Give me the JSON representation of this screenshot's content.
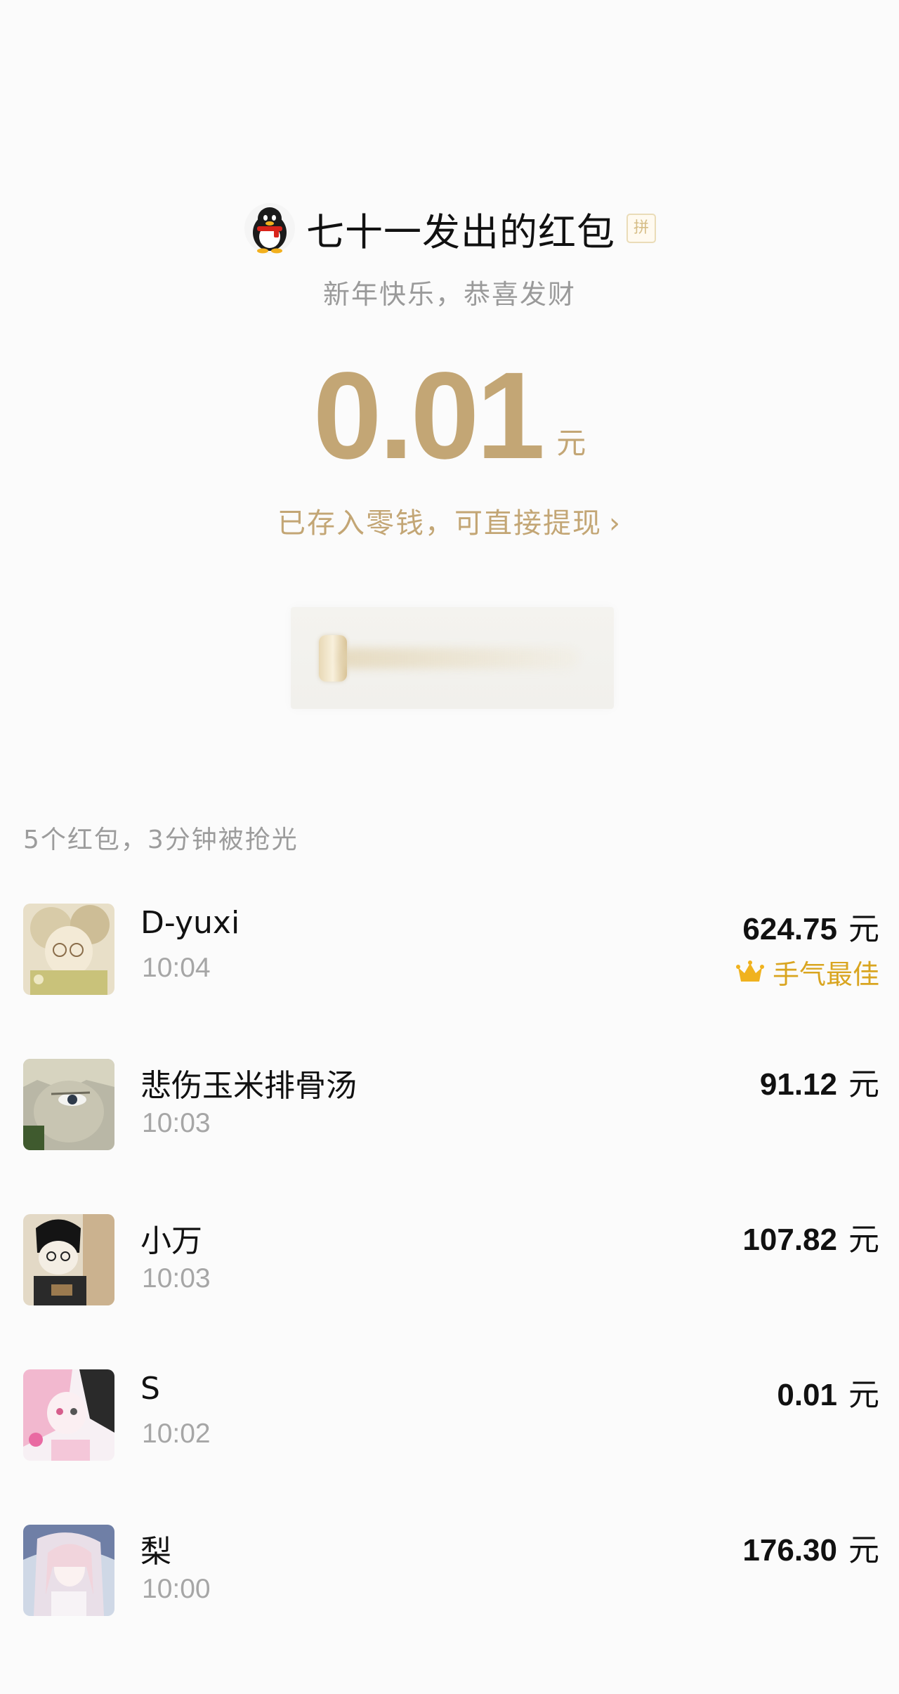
{
  "packet": {
    "title": "七十一发出的红包",
    "badge": "拼",
    "greeting": "新年快乐，恭喜发财",
    "amount": "0.01",
    "unit": "元",
    "saved_text": "已存入零钱，可直接提现",
    "chevron": "›"
  },
  "summary": "5个红包，3分钟被抢光",
  "records": [
    {
      "name": "D-yuxi",
      "time": "10:04",
      "amount": "624.75",
      "unit": "元",
      "best_label": "手气最佳"
    },
    {
      "name": "悲伤玉米排骨汤",
      "time": "10:03",
      "amount": "91.12",
      "unit": "元"
    },
    {
      "name": "小万",
      "time": "10:03",
      "amount": "107.82",
      "unit": "元"
    },
    {
      "name": "S",
      "time": "10:02",
      "amount": "0.01",
      "unit": "元"
    },
    {
      "name": "梨",
      "time": "10:00",
      "amount": "176.30",
      "unit": "元"
    }
  ],
  "colors": {
    "accent_gold": "#c3a675",
    "best_luck": "#d9a520",
    "muted_text": "#9c9c9c"
  },
  "icons": {
    "sender_avatar": "qq-penguin-avatar",
    "crown": "crown-icon",
    "chevron": "chevron-right-icon"
  }
}
